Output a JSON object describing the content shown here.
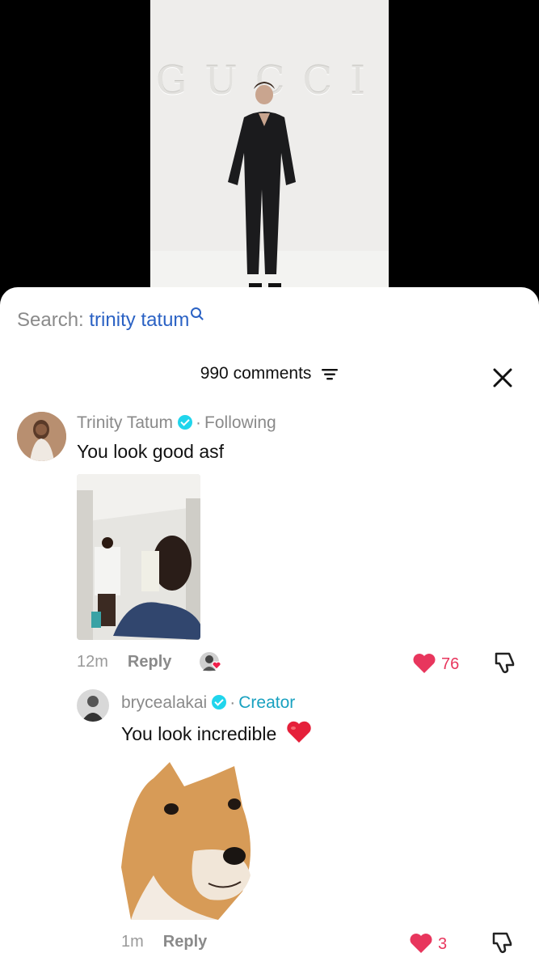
{
  "video": {
    "brand_sign": "GUCCI"
  },
  "search": {
    "prefix": "Search: ",
    "query": "trinity tatum"
  },
  "comments_header": {
    "count_label": "990 comments"
  },
  "comments": [
    {
      "author": "Trinity Tatum",
      "relation": "Following",
      "text": "You look good asf",
      "time": "12m",
      "reply_label": "Reply",
      "likes": "76"
    }
  ],
  "replies": [
    {
      "author": "brycealakai",
      "relation": "Creator",
      "text": "You look incredible",
      "time": "1m",
      "reply_label": "Reply",
      "likes": "3"
    }
  ],
  "colors": {
    "accent_like": "#e8365d",
    "verified": "#20d5ec",
    "search_query": "#2b62c4",
    "creator": "#19a1c0"
  }
}
